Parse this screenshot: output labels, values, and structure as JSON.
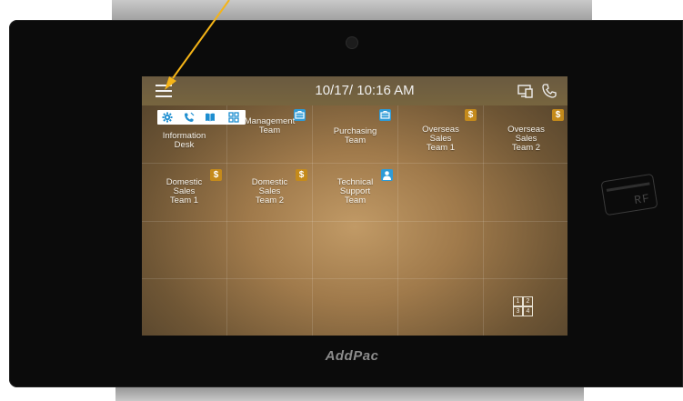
{
  "screen": {
    "datetime": "10/17/ 10:16 AM"
  },
  "brand": "AddPac",
  "rf_label": "RF",
  "quick_icons": [
    "gear-icon",
    "call-log-icon",
    "phonebook-icon",
    "apps-grid-icon"
  ],
  "tiles": [
    {
      "id": "information-desk",
      "label": "Information\nDesk",
      "badge": "none"
    },
    {
      "id": "management-team",
      "label": "Management\nTeam",
      "badge": "briefcase"
    },
    {
      "id": "purchasing-team",
      "label": "Purchasing\nTeam",
      "badge": "briefcase"
    },
    {
      "id": "overseas-sales-team-1",
      "label": "Overseas\nSales\nTeam  1",
      "badge": "$"
    },
    {
      "id": "overseas-sales-team-2",
      "label": "Overseas\nSales\nTeam  2",
      "badge": "$"
    },
    {
      "id": "domestic-sales-team-1",
      "label": "Domestic\nSales\nTeam  1",
      "badge": "$"
    },
    {
      "id": "domestic-sales-team-2",
      "label": "Domestic\nSales\nTeam  2",
      "badge": "$"
    },
    {
      "id": "technical-support-team",
      "label": "Technical\nSupport\nTeam",
      "badge": "user"
    }
  ],
  "page_switch": [
    "1",
    "2",
    "3",
    "4"
  ],
  "colors": {
    "accent_arrow": "#f5b417",
    "badge_dollar": "#c48a1b",
    "badge_blue": "#2e9bd7"
  }
}
